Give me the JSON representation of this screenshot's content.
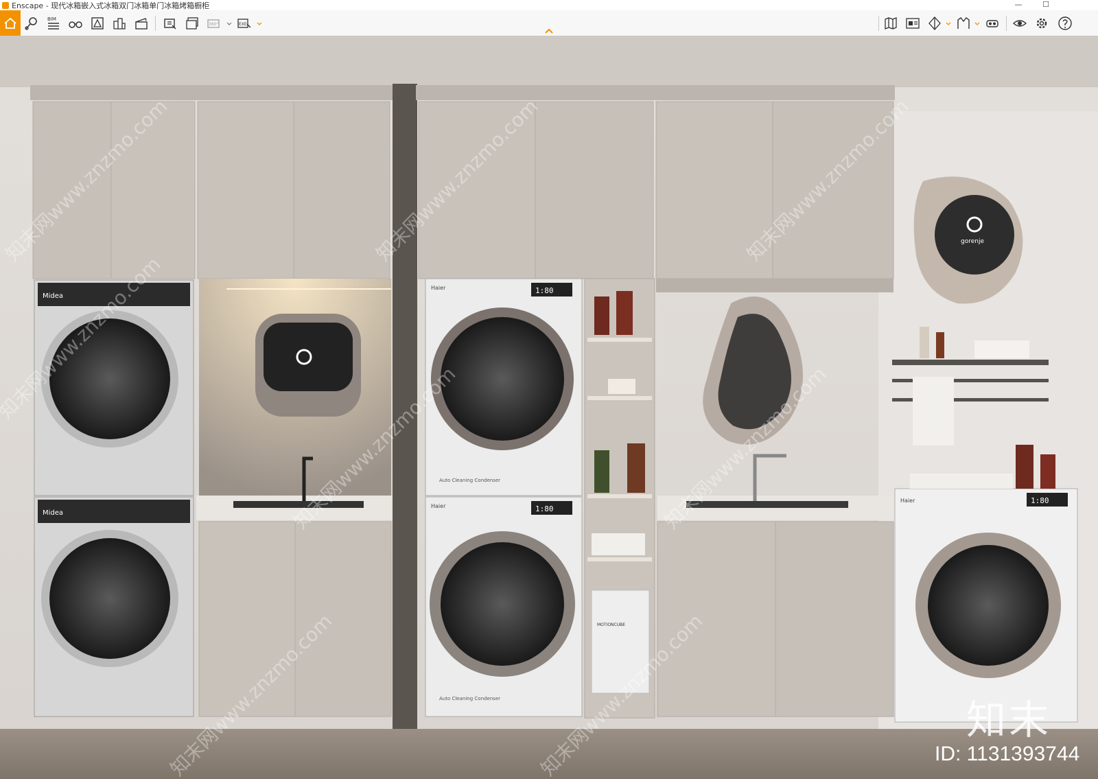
{
  "app": {
    "name": "Enscape",
    "window_title": "Enscape - 现代冰箱嵌入式冰箱双门冰箱单门冰箱烤箱橱柜"
  },
  "window_controls": {
    "minimize": "—",
    "maximize": "☐"
  },
  "toolbar": {
    "left_buttons": [
      "home-icon",
      "place-camera-icon",
      "bim-icon",
      "binoculars-icon",
      "asset-library-icon",
      "buildings-icon",
      "clapper-icon",
      "screenshot-icon",
      "batch-render-icon",
      "panorama-360-icon",
      "export-exe-icon"
    ],
    "right_buttons": [
      "map-icon",
      "material-editor-icon",
      "view-mode-icon",
      "sun-icon",
      "vr-headset-icon",
      "visual-settings-eye-icon",
      "settings-gear-icon",
      "help-icon"
    ],
    "bim_label": "BIM",
    "panorama_label": "360°",
    "exe_label": "EXE"
  },
  "scene": {
    "products": {
      "midea_brand": "Midea",
      "haier_brand": "Haier",
      "gorenje_brand": "gorenje",
      "display_time": "1:80",
      "condenser_label": "Auto Cleaning Condenser",
      "bin_label": "MOTIONCUBE"
    }
  },
  "watermark": {
    "logo_text": "知末",
    "id_text": "ID: 1131393744",
    "diagonal_text": "知末网www.znzmo.com"
  },
  "colors": {
    "accent": "#f39200",
    "wall": "#dcd7d2",
    "cabinet": "#c9c2bb",
    "floor": "#8e8377"
  }
}
